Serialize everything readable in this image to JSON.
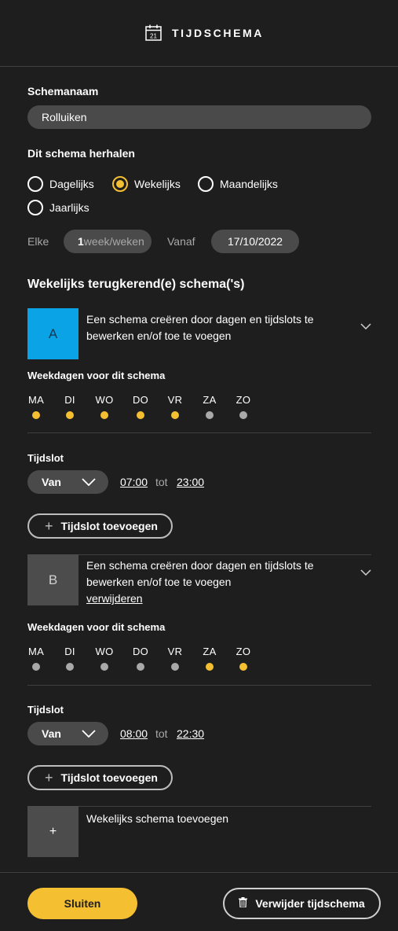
{
  "header": {
    "title": "TIJDSCHEMA",
    "calendar_day": "21"
  },
  "schedule_name": {
    "label": "Schemanaam",
    "value": "Rolluiken"
  },
  "repeat": {
    "label": "Dit schema herhalen",
    "options": [
      {
        "label": "Dagelijks",
        "selected": false
      },
      {
        "label": "Wekelijks",
        "selected": true
      },
      {
        "label": "Maandelijks",
        "selected": false
      },
      {
        "label": "Jaarlijks",
        "selected": false
      }
    ],
    "every_label": "Elke",
    "every_value": "1",
    "every_unit": "week/weken",
    "from_label": "Vanaf",
    "from_value": "17/10/2022"
  },
  "weekly_heading": "Wekelijks terugkerend(e) schema('s)",
  "schedules": [
    {
      "letter": "A",
      "description": "Een schema creëren door dagen en tijdslots te bewerken en/of toe te voegen",
      "weekdays_label": "Weekdagen voor dit schema",
      "days": [
        {
          "label": "MA",
          "active": true
        },
        {
          "label": "DI",
          "active": true
        },
        {
          "label": "WO",
          "active": true
        },
        {
          "label": "DO",
          "active": true
        },
        {
          "label": "VR",
          "active": true
        },
        {
          "label": "ZA",
          "active": false
        },
        {
          "label": "ZO",
          "active": false
        }
      ],
      "timeslot_label": "Tijdslot",
      "mode": "Van",
      "from": "07:00",
      "to_label": "tot",
      "to": "23:00",
      "add_timeslot": "Tijdslot toevoegen"
    },
    {
      "letter": "B",
      "description": "Een schema creëren door dagen en tijdslots te bewerken en/of toe te voegen",
      "remove_link": "verwijderen",
      "weekdays_label": "Weekdagen voor dit schema",
      "days": [
        {
          "label": "MA",
          "active": false
        },
        {
          "label": "DI",
          "active": false
        },
        {
          "label": "WO",
          "active": false
        },
        {
          "label": "DO",
          "active": false
        },
        {
          "label": "VR",
          "active": false
        },
        {
          "label": "ZA",
          "active": true
        },
        {
          "label": "ZO",
          "active": true
        }
      ],
      "timeslot_label": "Tijdslot",
      "mode": "Van",
      "from": "08:00",
      "to_label": "tot",
      "to": "22:30",
      "add_timeslot": "Tijdslot toevoegen"
    }
  ],
  "add_weekly": {
    "symbol": "+",
    "label": "Wekelijks schema toevoegen"
  },
  "footer": {
    "close": "Sluiten",
    "delete": "Verwijder tijdschema"
  },
  "colors": {
    "accent": "#f5bf32",
    "schedule_a": "#0aa3e5",
    "background": "#1e1e1e"
  }
}
